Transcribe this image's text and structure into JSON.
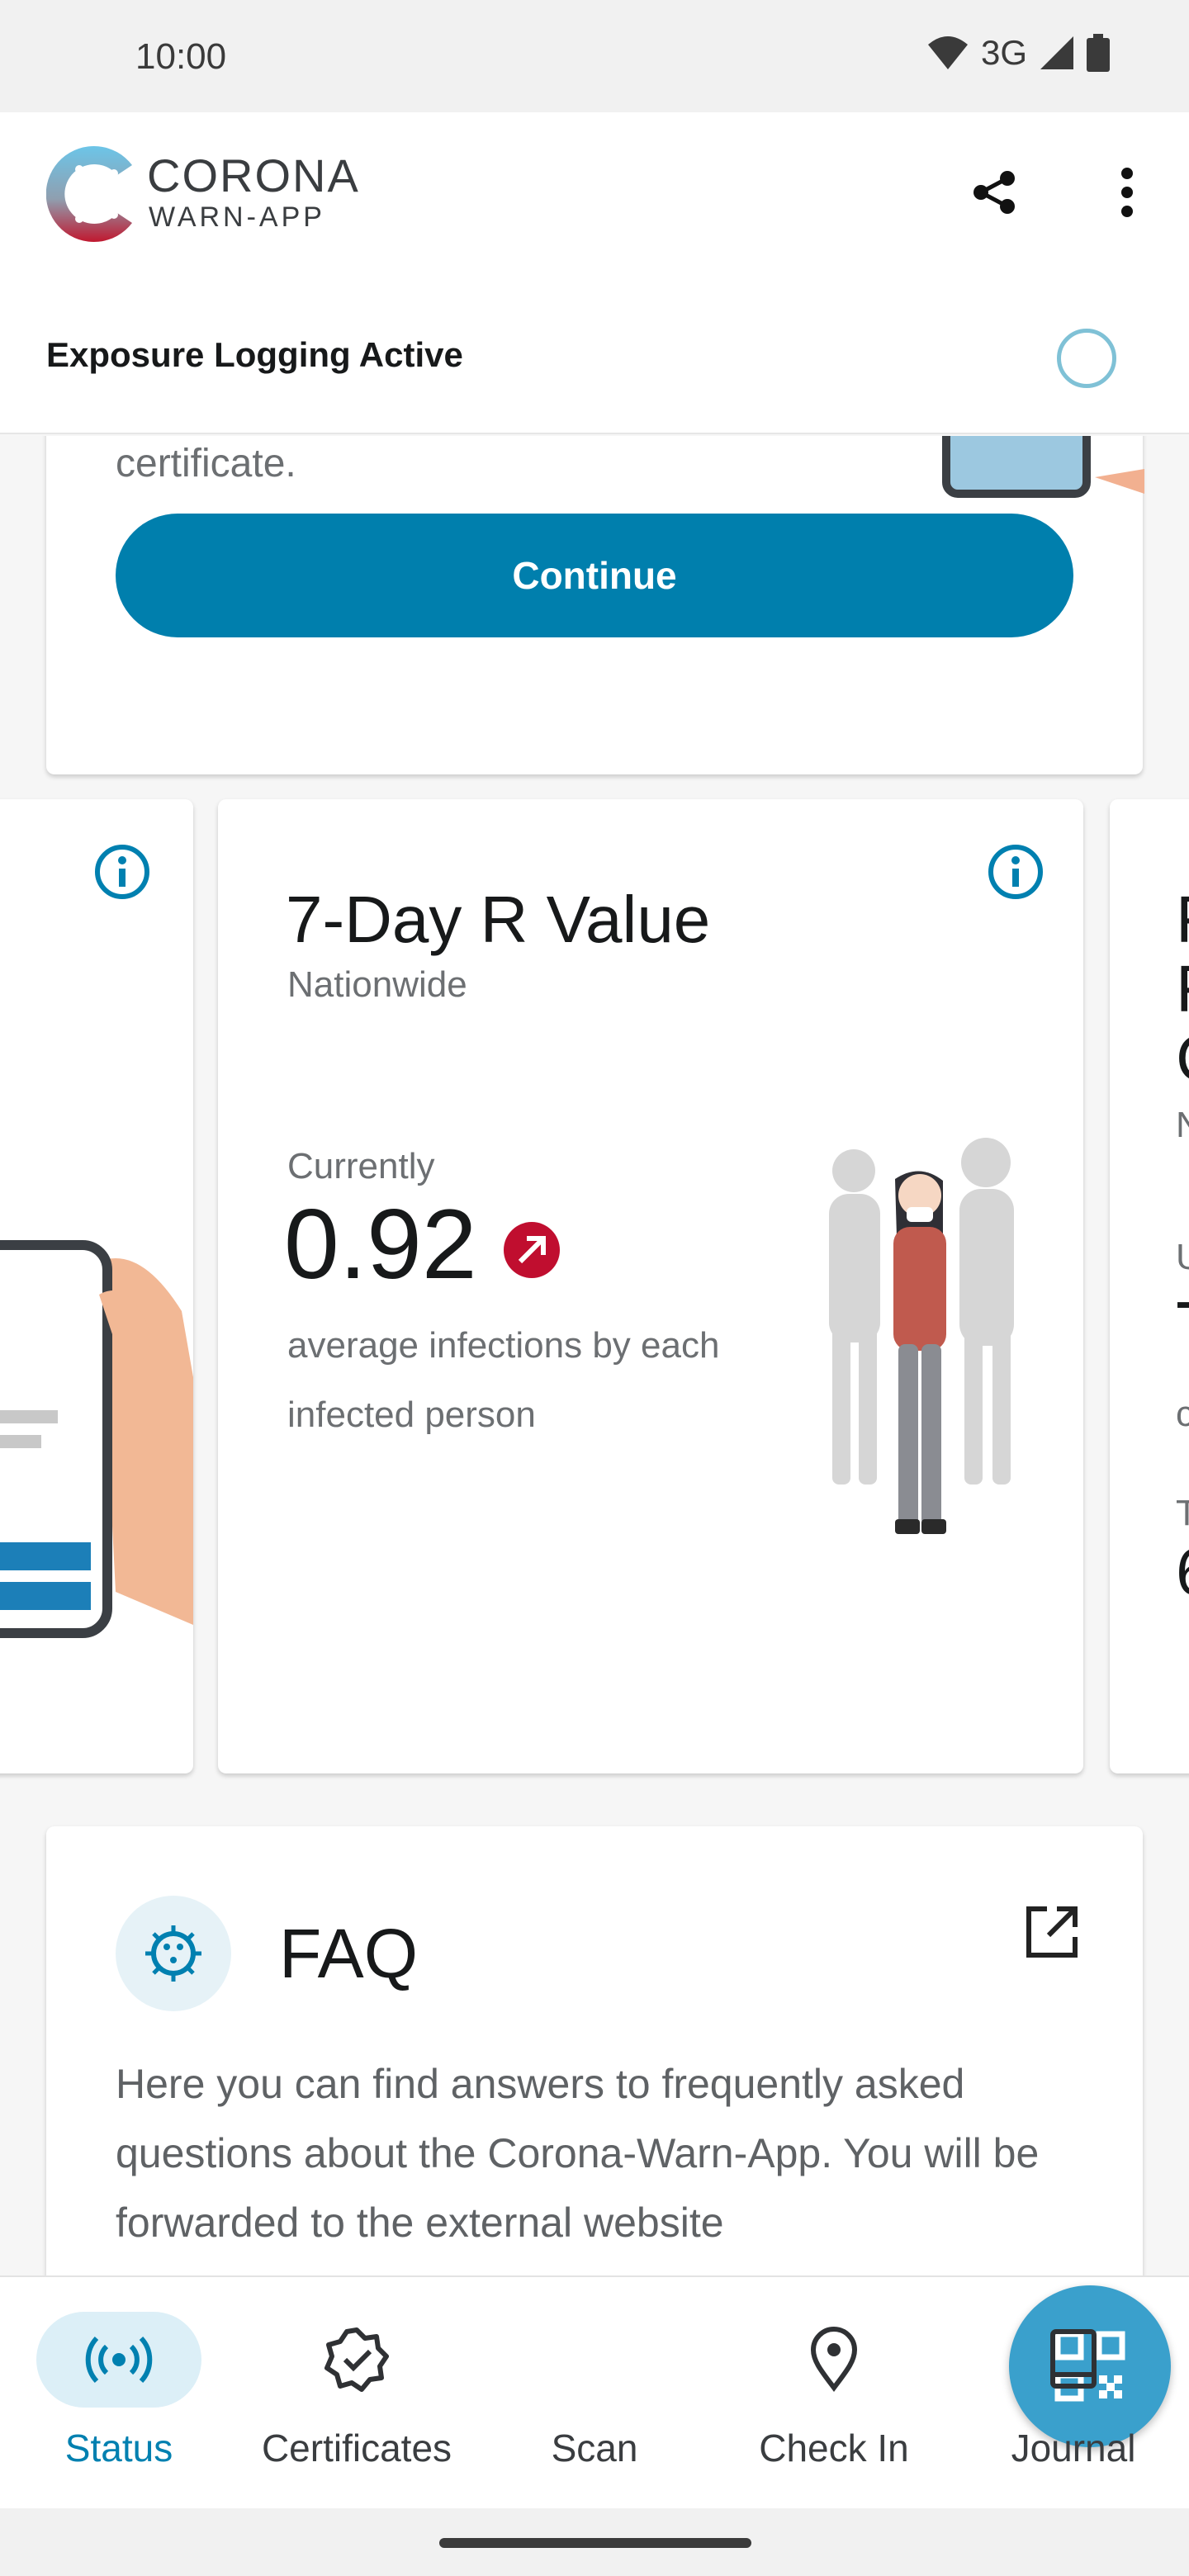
{
  "status_bar": {
    "time": "10:00",
    "network": "3G"
  },
  "header": {
    "brand_name": "CORONA",
    "brand_sub": "WARN-APP",
    "exposure_status": "Exposure Logging Active",
    "icons": [
      "share-icon",
      "more-vert-icon"
    ]
  },
  "top_card": {
    "text_tail": "certificate.",
    "continue_label": "Continue"
  },
  "statistics": {
    "r_value": {
      "title": "7-Day R Value",
      "subtitle": "Nationwide",
      "currently_label": "Currently",
      "value": "0.92",
      "trend": "increasing",
      "description": "average infections by each infected person"
    },
    "right_card_fragments": [
      "F",
      "F",
      "C",
      "N",
      "U",
      "T",
      "c",
      "T",
      "6"
    ]
  },
  "faq": {
    "title": "FAQ",
    "body": "Here you can find answers to frequently asked questions about the Corona-Warn-App. You will be forwarded to the external website"
  },
  "bottom_nav": {
    "items": [
      {
        "label": "Status",
        "icon": "status-broadcast-icon",
        "active": true
      },
      {
        "label": "Certificates",
        "icon": "certificate-badge-icon",
        "active": false
      },
      {
        "label": "Scan",
        "icon": "qr-code-icon",
        "active": false
      },
      {
        "label": "Check In",
        "icon": "location-pin-icon",
        "active": false
      },
      {
        "label": "Journal",
        "icon": "journal-book-icon",
        "active": false
      }
    ]
  },
  "colors": {
    "primary": "#007fad",
    "trend_red": "#c00e2f",
    "fab": "#3aa0cc",
    "active_nav_bg": "#dceff7"
  }
}
